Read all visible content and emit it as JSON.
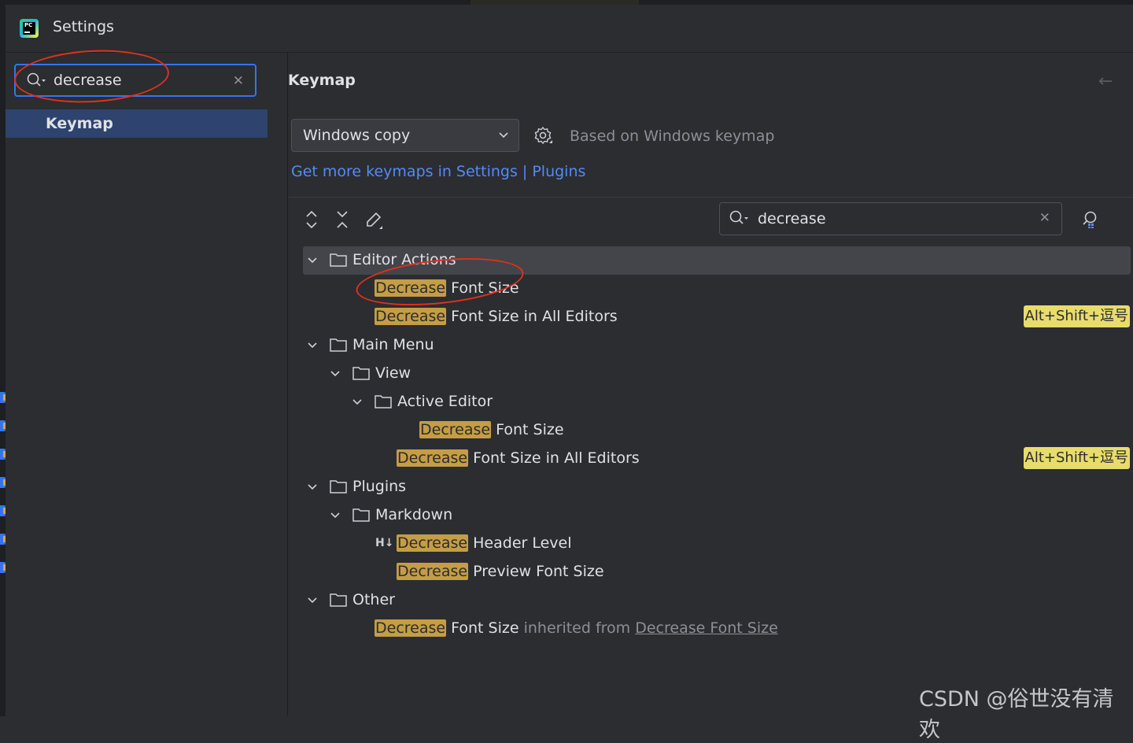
{
  "window": {
    "title": "Settings"
  },
  "sidebar": {
    "search": {
      "value": "decrease"
    },
    "items": [
      {
        "label": "Keymap",
        "selected": true
      }
    ]
  },
  "main": {
    "title": "Keymap",
    "keymap_select": {
      "value": "Windows copy"
    },
    "based_on": "Based on Windows keymap",
    "more_link": "Get more keymaps in Settings | Plugins",
    "search": {
      "value": "decrease"
    }
  },
  "tree": {
    "editor_actions": {
      "label": "Editor Actions",
      "items": [
        {
          "hl": "Decrease",
          "rest": " Font Size",
          "shortcut": ""
        },
        {
          "hl": "Decrease",
          "rest": " Font Size in All Editors",
          "shortcut": "Alt+Shift+逗号"
        }
      ]
    },
    "main_menu": {
      "label": "Main Menu",
      "view": {
        "label": "View",
        "active_editor": {
          "label": "Active Editor",
          "items": [
            {
              "hl": "Decrease",
              "rest": " Font Size"
            }
          ]
        },
        "items": [
          {
            "hl": "Decrease",
            "rest": " Font Size in All Editors",
            "shortcut": "Alt+Shift+逗号"
          }
        ]
      }
    },
    "plugins": {
      "label": "Plugins",
      "markdown": {
        "label": "Markdown",
        "items": [
          {
            "icon": "H↓",
            "hl": "Decrease",
            "rest": " Header Level"
          },
          {
            "hl": "Decrease",
            "rest": " Preview Font Size"
          }
        ]
      }
    },
    "other": {
      "label": "Other",
      "items": [
        {
          "hl": "Decrease",
          "rest": " Font Size",
          "inherited_text": " inherited from ",
          "inherited_link": "Decrease Font Size"
        }
      ]
    }
  },
  "watermark": "CSDN @俗世没有清欢",
  "colors": {
    "accent": "#3574f0",
    "highlight": "#c59d44",
    "shortcut_bg": "#e8dc6b",
    "link": "#548af7",
    "annotation": "#e0301e"
  }
}
